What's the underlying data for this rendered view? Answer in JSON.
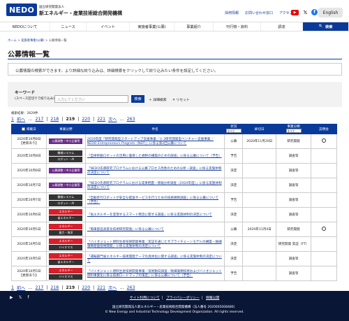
{
  "header": {
    "logo_text": "NEDO",
    "org_sub": "国立研究開発法人",
    "org_name": "新エネルギー・産業技術総合開発機構",
    "links": [
      "採用情報",
      "お問い合わせ窓口",
      "アクセス"
    ],
    "english_label": "English",
    "icons": [
      "youtube-icon",
      "x-icon",
      "facebook-icon"
    ]
  },
  "nav": {
    "items": [
      "NEDOについて",
      "ニュース",
      "イベント",
      "実施者事業(公募)",
      "事業紹介",
      "刊行物・資料",
      "調達"
    ],
    "search_label": "検索"
  },
  "breadcrumb": [
    "ホーム",
    "実施者事業(公募)",
    "公募情報一覧"
  ],
  "page": {
    "title": "公募情報一覧",
    "intro": "公募情報の検索ができます。より詳細な絞り込みは、詳細検索をクリックして絞り込みたい条件を設定してください。"
  },
  "keyword": {
    "label": "キーワード",
    "sublabel": "(スペース区切りで絞り込み)",
    "placeholder": "入力してください",
    "search_button": "検索",
    "advanced": "＋ 詳細検索",
    "reset": "✕ リセット"
  },
  "results": {
    "count_text": "検索結果：2629件",
    "pager": {
      "first": "1",
      "prev": "前へ",
      "pages": [
        "217",
        "218",
        "219",
        "220",
        "221"
      ],
      "current": "219",
      "next": "次へ",
      "last": "263"
    }
  },
  "table": {
    "headers": {
      "date": "掲載日",
      "category": "事業分野",
      "title": "件名",
      "status": "状況",
      "status_select": "すべて",
      "deadline": "締切日",
      "type": "事業分類",
      "type_select": "すべて",
      "briefing": "説明会"
    },
    "rows": [
      {
        "date": "2020年10月8日",
        "updated": "【更新あり】",
        "cats": [
          {
            "label": "公募調整・中小企業等",
            "c": "p"
          }
        ],
        "title": "2020年度「研究開発型スタートアップ支援事業／①-2研究開発型ベンチャー支援事業／NEDO Entrepreneurs Program（NEP）」に係る第2回公募について",
        "status": "公募",
        "deadline": "2020年11月20日",
        "type": "研究開発",
        "brief": "○"
      },
      {
        "date": "2020年10月8日",
        "updated": "",
        "cats": [
          {
            "label": "機械システム",
            "c": "d"
          },
          {
            "label": "ロボット・AI",
            "c": "d"
          }
        ],
        "title": "「自律移動ロボットの活用に着目した規制の構築のための調査」に係る公募について（予告）",
        "status": "予告",
        "deadline": "",
        "type": "調査等",
        "brief": ""
      },
      {
        "date": "2020年10月8日",
        "updated": "",
        "cats": [
          {
            "label": "公募調整・中小企業等",
            "c": "p"
          }
        ],
        "title": "「NEDO先導研究プログラムにおける公募プロセス改善のための分析・調査」に係る実施体制の決定について",
        "status": "決定",
        "deadline": "",
        "type": "調査等",
        "brief": ""
      },
      {
        "date": "2020年10月7日",
        "updated": "",
        "cats": [
          {
            "label": "公募調整・中小企業等",
            "c": "p"
          }
        ],
        "title": "「NEDO先導研究プログラムにおける成果把握・情報分析調査（2020年度）」に係る実施体制の決定について",
        "status": "決定",
        "deadline": "",
        "type": "調査等",
        "brief": ""
      },
      {
        "date": "2020年10月7日",
        "updated": "",
        "cats": [
          {
            "label": "機械システム",
            "c": "d"
          },
          {
            "label": "ロボット・AI",
            "c": "d"
          }
        ],
        "title": "「自動走行ロボットが安全な配送サービスを行うための技術規制調査」に係る公募について（予告）",
        "status": "予告",
        "deadline": "",
        "type": "調査等",
        "brief": ""
      },
      {
        "date": "2020年10月6日",
        "updated": "",
        "cats": [
          {
            "label": "エネルギー",
            "c": "r"
          },
          {
            "label": "省エネルギー",
            "c": "d"
          }
        ],
        "title": "「省エネルギーを実現するスマート物流に関する調査」に係る実施体制の決定について",
        "status": "決定",
        "deadline": "",
        "type": "調査等",
        "brief": ""
      },
      {
        "date": "2020年10月5日",
        "updated": "",
        "cats": [
          {
            "label": "エネルギー",
            "c": "r"
          },
          {
            "label": "風力・海洋",
            "c": "d"
          }
        ],
        "title": "「風車部品高度化技術研究開発」に係る公募について",
        "status": "公募",
        "deadline": "2020年11月4日",
        "type": "研究開発",
        "brief": "○"
      },
      {
        "date": "2020年10月5日",
        "updated": "",
        "cats": [
          {
            "label": "エネルギー",
            "c": "r"
          },
          {
            "label": "バイオマス",
            "c": "d"
          }
        ],
        "title": "「バイオジェット燃料生産技術開発事業／実証を通じたサプライチェーンモデルの構築・微細藻類基盤技術開発」に係る実施体制の決定について",
        "status": "決定",
        "deadline": "",
        "type": "研究開発 実証（FT）",
        "brief": ""
      },
      {
        "date": "2020年10月5日",
        "updated": "",
        "cats": [
          {
            "label": "エネルギー",
            "c": "r"
          },
          {
            "label": "省エネルギー",
            "c": "d"
          }
        ],
        "title": "「運輸部門省エネルギー技術開発テーマの具体化に関する調査」に係る実施体制の決定について",
        "status": "決定",
        "deadline": "",
        "type": "調査等",
        "brief": ""
      },
      {
        "date": "2020年10月5日",
        "updated": "【更新あり】",
        "cats": [
          {
            "label": "エネルギー",
            "c": "r"
          },
          {
            "label": "バイオマス",
            "c": "d"
          }
        ],
        "title": "「バイオジェット燃料生産技術開発事業／技術動向調査／微細藻類技術およびバイオジェット燃料事業化に係る技術ロードマップの策定」に係る公募について（予告）",
        "status": "予告",
        "deadline": "",
        "type": "調査等",
        "brief": ""
      }
    ]
  },
  "footer": {
    "links": [
      "サイト利用について",
      "プライバシーポリシー",
      "情報公開"
    ],
    "org": "国立研究開発法人新エネルギー・産業技術総合開発機構（法人番号 2020005008480）",
    "copyright": "© New Energy and Industrial Technology Development Organization. All rights reserved."
  }
}
